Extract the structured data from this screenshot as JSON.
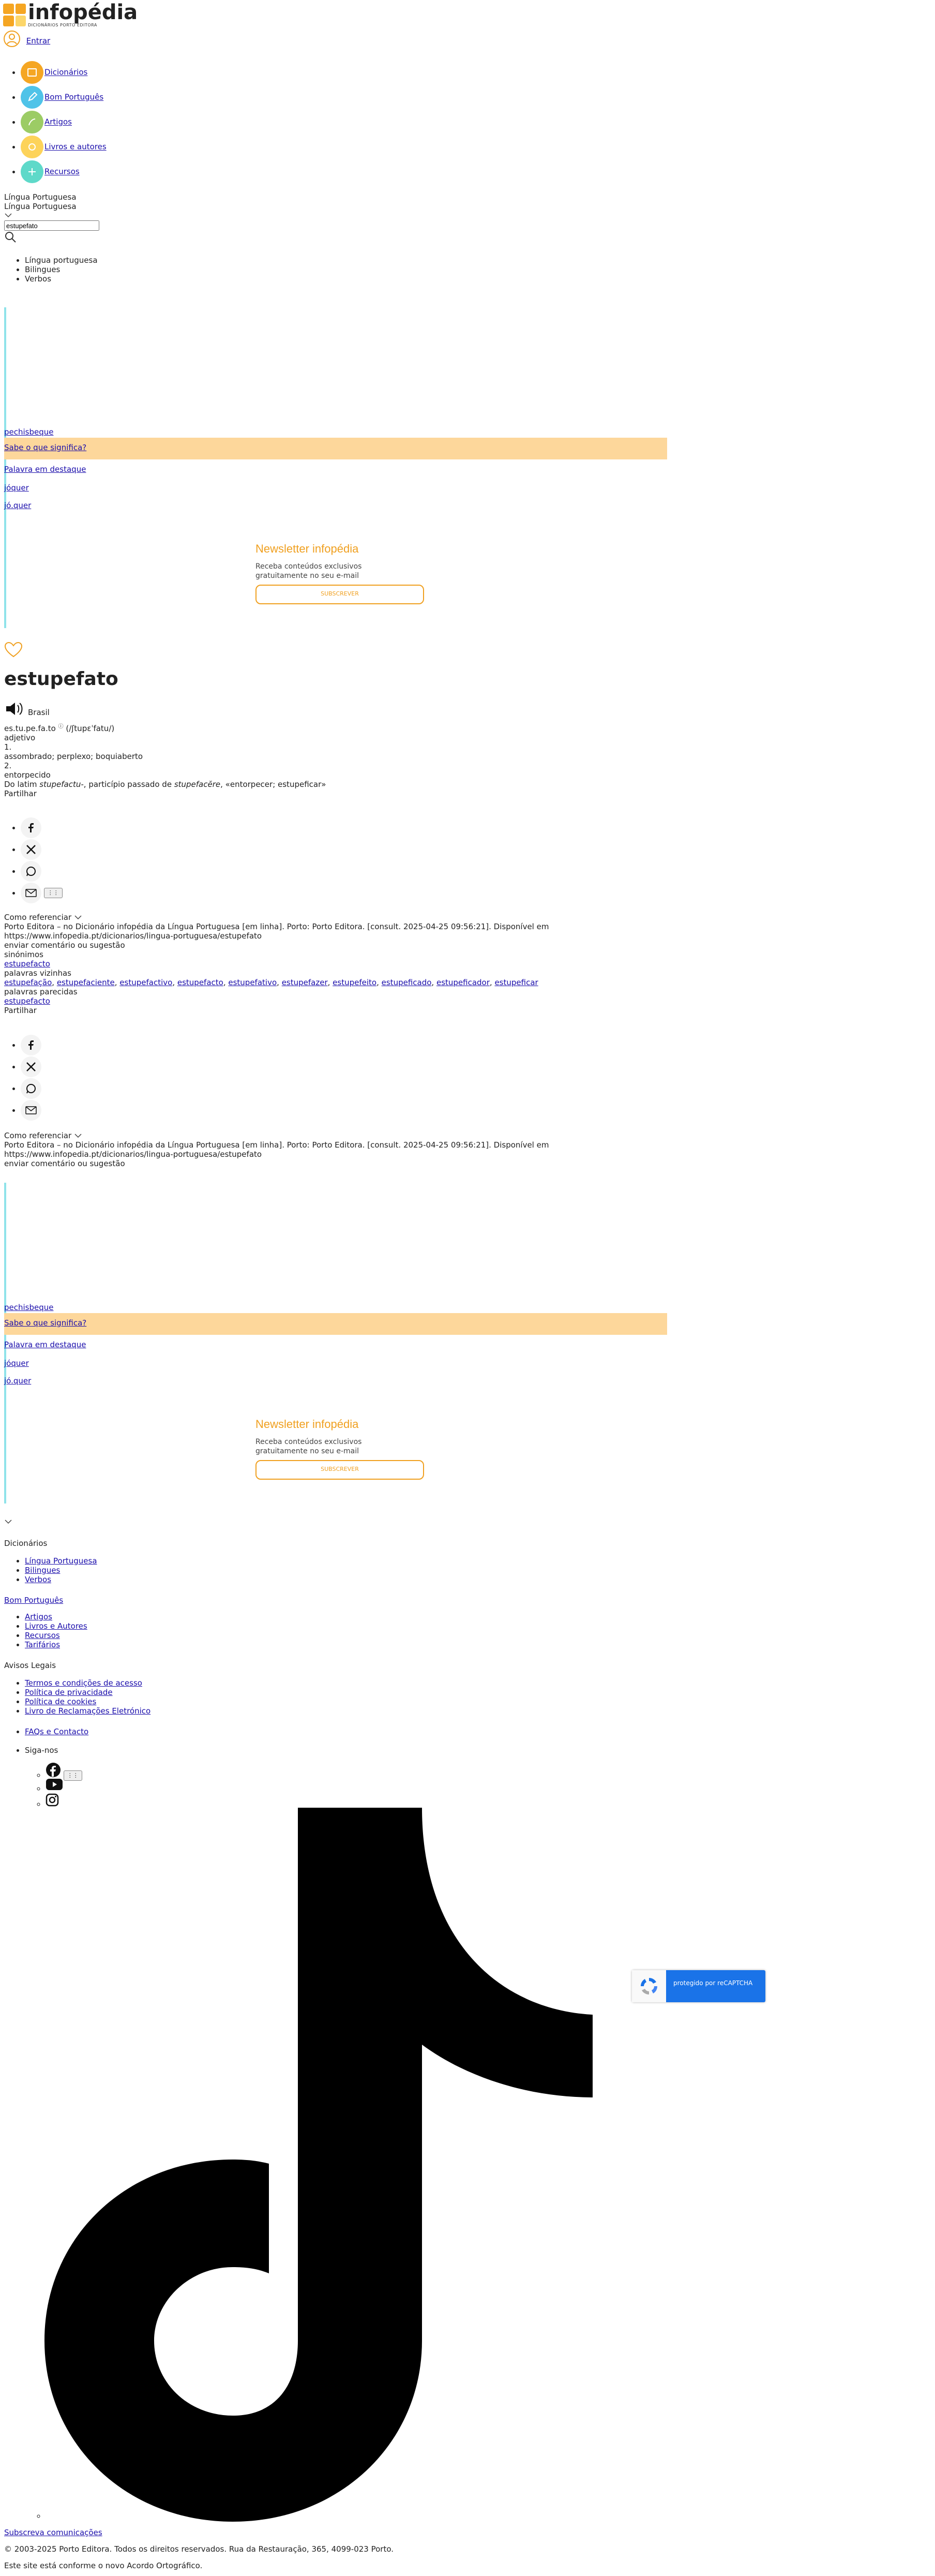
{
  "brand": {
    "name": "infopédia",
    "tagline": "DICIONÁRIOS PORTO EDITORA"
  },
  "header": {
    "login": "Entrar"
  },
  "nav": [
    {
      "label": "Dicionários",
      "color": "#f5a623",
      "icon": "book-icon"
    },
    {
      "label": "Bom Português",
      "color": "#4fc3e8",
      "icon": "pencil-icon"
    },
    {
      "label": "Artigos",
      "color": "#9ccc65",
      "icon": "article-icon"
    },
    {
      "label": "Livros e autores",
      "color": "#fdd35a",
      "icon": "books-icon"
    },
    {
      "label": "Recursos",
      "color": "#5ed9c9",
      "icon": "resources-icon"
    }
  ],
  "search": {
    "dictionary": "Língua Portuguesa",
    "dictionary_selected": "Língua Portuguesa",
    "value": "estupefato",
    "suggestions": [
      "Língua portuguesa",
      "Bilingues",
      "Verbos"
    ]
  },
  "promo": {
    "tiles": [
      {
        "label": "pechisbeque"
      },
      {
        "label": "Sabe o que significa?"
      },
      {
        "label": "Palavra em destaque"
      },
      {
        "label": "jóquer"
      },
      {
        "label": "jó.quer"
      }
    ],
    "newsletter": {
      "title": "Newsletter infopédia",
      "line1": "Receba conteúdos exclusivos",
      "line2": "gratuitamente no seu e-mail",
      "button": "SUBSCREVER"
    }
  },
  "entry": {
    "word": "estupefato",
    "variant_label": "Brasil",
    "syllables": "es.tu.pe.fa.to",
    "pronunciation": "ʃtupɛˈfatu",
    "pos": "adjetivo",
    "sense1_num": "1.",
    "sense1_text": "assombrado; perplexo; boquiaberto",
    "sense2_num": "2.",
    "sense2_text": "entorpecido",
    "etymology_pre": "Do latim ",
    "etymology_word": "stupefactu-",
    "etymology_mid": ", particípio passado de ",
    "etymology_word2": "stupefacĕre",
    "etymology_post": ", «entorpecer; estupeficar»",
    "share_label": "Partilhar",
    "cite_label": "Como referenciar",
    "cite_text": "Porto Editora – no Dicionário infopédia da Língua Portuguesa [em linha]. Porto: Porto Editora. [consult. 2025-04-25 09:56:21]. Disponível em https://www.infopedia.pt/dicionarios/lingua-portuguesa/estupefato",
    "feedback": "enviar comentário ou sugestão",
    "dots": "⋮⋮",
    "synonyms_label": "sinónimos",
    "synonym": "estupefacto",
    "neighbors_label": "palavras vizinhas",
    "neighbors": [
      "estupefação",
      "estupefaciente",
      "estupefactivo",
      "estupefacto",
      "estupefativo",
      "estupefazer",
      "estupefeito",
      "estupeficado",
      "estupeficador",
      "estupeficar"
    ],
    "similar_label": "palavras parecidas",
    "similar": "estupefacto"
  },
  "footer": {
    "dictionaries_title": "Dicionários",
    "dictionaries": [
      "Língua Portuguesa",
      "Bilingues",
      "Verbos"
    ],
    "bom_portugues": "Bom Português",
    "links": [
      "Artigos",
      "Livros e Autores",
      "Recursos",
      "Tarifários"
    ],
    "legal_title": "Avisos Legais",
    "legal": [
      "Termos e condições de acesso",
      "Política de privacidade",
      "Política de cookies",
      "Livro de Reclamações Eletrónico"
    ],
    "faq": "FAQs e Contacto",
    "follow": "Siga-nos",
    "subscribe": "Subscreva comunicações",
    "copyright": "© 2003-2025 Porto Editora. Todos os direitos reservados. Rua da Restauração, 365, 4099-023 Porto.",
    "orthography": "Este site está conforme o novo Acordo Ortográfico."
  },
  "recaptcha": {
    "label": "protegido por reCAPTCHA"
  }
}
